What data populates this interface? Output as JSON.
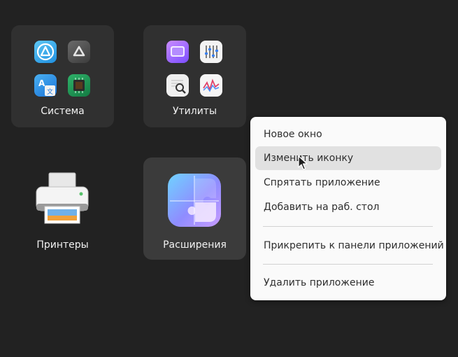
{
  "folders": [
    {
      "label": "Система",
      "apps": [
        "app-center-icon",
        "software-updater-icon",
        "language-support-icon",
        "hardware-chip-icon"
      ]
    },
    {
      "label": "Утилиты",
      "apps": [
        "screenshot-icon",
        "settings-sliders-icon",
        "document-viewer-icon",
        "system-monitor-icon"
      ]
    }
  ],
  "apps": [
    {
      "label": "Принтеры",
      "icon": "printer-icon"
    },
    {
      "label": "Расширения",
      "icon": "puzzle-extensions-icon"
    }
  ],
  "context_menu": {
    "items": [
      "Новое окно",
      "Изменить иконку",
      "Спрятать приложение",
      "Добавить на раб. стол",
      "Прикрепить к панели приложений",
      "Удалить приложение"
    ],
    "hovered_index": 1
  },
  "colors": {
    "background": "#222222",
    "folder_bg": "#303030",
    "menu_bg": "#fafafa",
    "menu_hover": "#e1e1e1"
  }
}
